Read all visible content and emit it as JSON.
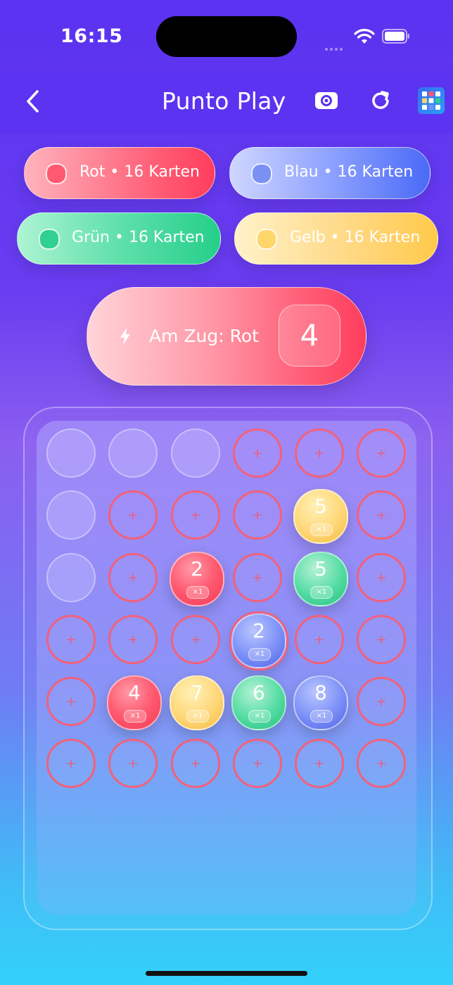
{
  "status": {
    "time": "16:15"
  },
  "header": {
    "title": "Punto Play"
  },
  "players": [
    {
      "label": "Rot • 16 Karten",
      "color": "#ff5a72"
    },
    {
      "label": "Blau • 16 Karten",
      "color": "#7a90f5"
    },
    {
      "label": "Grün • 16 Karten",
      "color": "#2fd090"
    },
    {
      "label": "Gelb • 16 Karten",
      "color": "#ffd66a"
    }
  ],
  "turn": {
    "label": "Am Zug: Rot",
    "card_value": "4"
  },
  "board": {
    "rows": 6,
    "cols": 6,
    "cells": [
      [
        "disabled",
        "disabled",
        "disabled",
        "empty",
        "empty",
        "empty"
      ],
      [
        "disabled",
        "empty",
        "empty",
        "empty",
        {
          "color": "yellow",
          "value": "5",
          "count": "×1"
        },
        "empty"
      ],
      [
        "disabled",
        "empty",
        {
          "color": "red",
          "value": "2",
          "count": "×1"
        },
        "empty",
        {
          "color": "green",
          "value": "5",
          "count": "×1"
        },
        "empty"
      ],
      [
        "empty",
        "empty",
        "empty",
        {
          "color": "blue",
          "value": "2",
          "count": "×1",
          "ring": true
        },
        "empty",
        "empty"
      ],
      [
        "empty",
        {
          "color": "red",
          "value": "4",
          "count": "×1"
        },
        {
          "color": "yellow",
          "value": "7",
          "count": "×1"
        },
        {
          "color": "green",
          "value": "6",
          "count": "×1"
        },
        {
          "color": "blue",
          "value": "8",
          "count": "×1"
        },
        "empty"
      ],
      [
        "empty",
        "empty",
        "empty",
        "empty",
        "empty",
        "empty"
      ]
    ],
    "plus_symbol": "+"
  }
}
